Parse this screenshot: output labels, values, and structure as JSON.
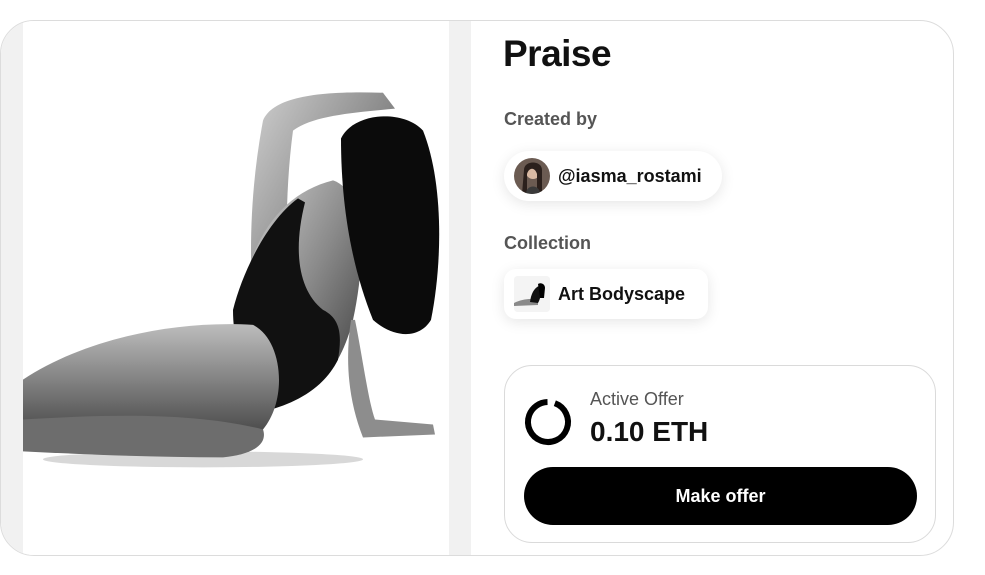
{
  "nft": {
    "title": "Praise",
    "created_by_label": "Created by",
    "creator": {
      "handle": "@iasma_rostami",
      "avatar_icon": "creator-avatar"
    },
    "collection_label": "Collection",
    "collection": {
      "name": "Art Bodyscape",
      "thumb_icon": "collection-thumbnail"
    },
    "artwork_icon": "pencil-drawing-artwork"
  },
  "offer": {
    "label": "Active Offer",
    "amount": "0.10 ETH",
    "status_icon": "ring-icon",
    "button_label": "Make offer"
  },
  "colors": {
    "button_bg": "#000000",
    "button_text": "#ffffff",
    "label_gray": "#555555",
    "border": "#dcdcdc"
  }
}
